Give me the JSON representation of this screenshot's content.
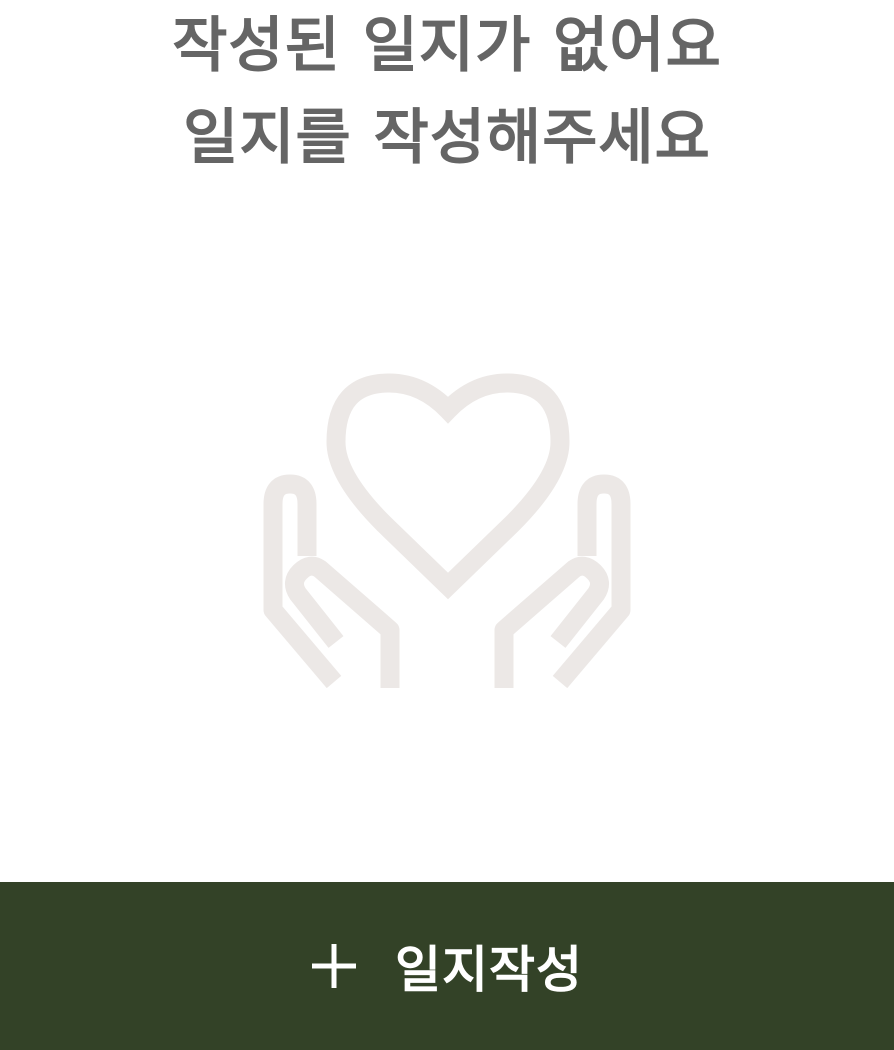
{
  "empty_state": {
    "title_line_1": "작성된 일지가 없어요",
    "title_line_2": "일지를 작성해주세요",
    "illustration_icon": "hands-holding-heart-icon"
  },
  "write_button": {
    "icon": "plus-icon",
    "label": "일지작성"
  },
  "colors": {
    "background": "#ffffff",
    "message_text": "#656565",
    "illustration": "#ece8e6",
    "button_background": "#334227",
    "button_text": "#ffffff"
  }
}
